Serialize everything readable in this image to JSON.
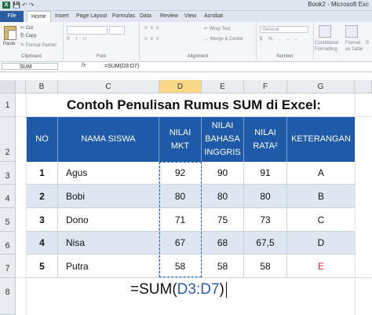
{
  "window": {
    "title": "Book2 - Microsoft Exc",
    "app_icon": "X"
  },
  "tabs": [
    "File",
    "Home",
    "Insert",
    "Page Layout",
    "Formulas",
    "Data",
    "Review",
    "View",
    "Acrobat"
  ],
  "ribbon": {
    "clipboard": {
      "paste": "Paste",
      "cut": "Cut",
      "copy": "Copy",
      "format_painter": "Format Painter",
      "label": "Clipboard"
    },
    "font": {
      "label": "Font"
    },
    "alignment": {
      "wrap": "Wrap Text",
      "merge": "Merge & Center",
      "label": "Alignment"
    },
    "number": {
      "format": "General",
      "label": "Number"
    },
    "styles": {
      "conditional": "Conditional",
      "conditional2": "Formatting",
      "format_as": "Format",
      "format_as2": "as Table",
      "cell": "S"
    }
  },
  "formula_bar": {
    "name_box": "SUM",
    "fx": "fx",
    "formula": "=SUM(D3:D7)"
  },
  "columns": [
    "B",
    "C",
    "D",
    "E",
    "F",
    "G"
  ],
  "rows": [
    "1",
    "2",
    "3",
    "4",
    "5",
    "6",
    "7",
    "8"
  ],
  "sheet_title": "Contoh Penulisan Rumus SUM di Excel:",
  "table": {
    "headers": {
      "no": "NO",
      "nama": "NAMA SISWA",
      "mkt1": "NILAI",
      "mkt2": "MKT",
      "ing1": "NILAI",
      "ing2": "BAHASA",
      "ing3": "INGGRIS",
      "rata1": "NILAI",
      "rata2": "RATA²",
      "ket": "KETERANGAN"
    },
    "rows": [
      {
        "no": "1",
        "nama": "Agus",
        "mkt": "92",
        "ing": "90",
        "rata": "91",
        "ket": "A"
      },
      {
        "no": "2",
        "nama": "Bobi",
        "mkt": "80",
        "ing": "80",
        "rata": "80",
        "ket": "B"
      },
      {
        "no": "3",
        "nama": "Dono",
        "mkt": "71",
        "ing": "75",
        "rata": "73",
        "ket": "C"
      },
      {
        "no": "4",
        "nama": "Nisa",
        "mkt": "67",
        "ing": "68",
        "rata": "67,5",
        "ket": "D"
      },
      {
        "no": "5",
        "nama": "Putra",
        "mkt": "58",
        "ing": "58",
        "rata": "58",
        "ket": "E"
      }
    ]
  },
  "formula_cell": {
    "prefix": "=SUM(",
    "range": "D3:D7",
    "suffix": ")"
  },
  "colors": {
    "header_blue": "#1e5aa8",
    "stripe": "#dde6f1",
    "fail_red": "#d9262b",
    "selected_col": "#f8d886"
  }
}
